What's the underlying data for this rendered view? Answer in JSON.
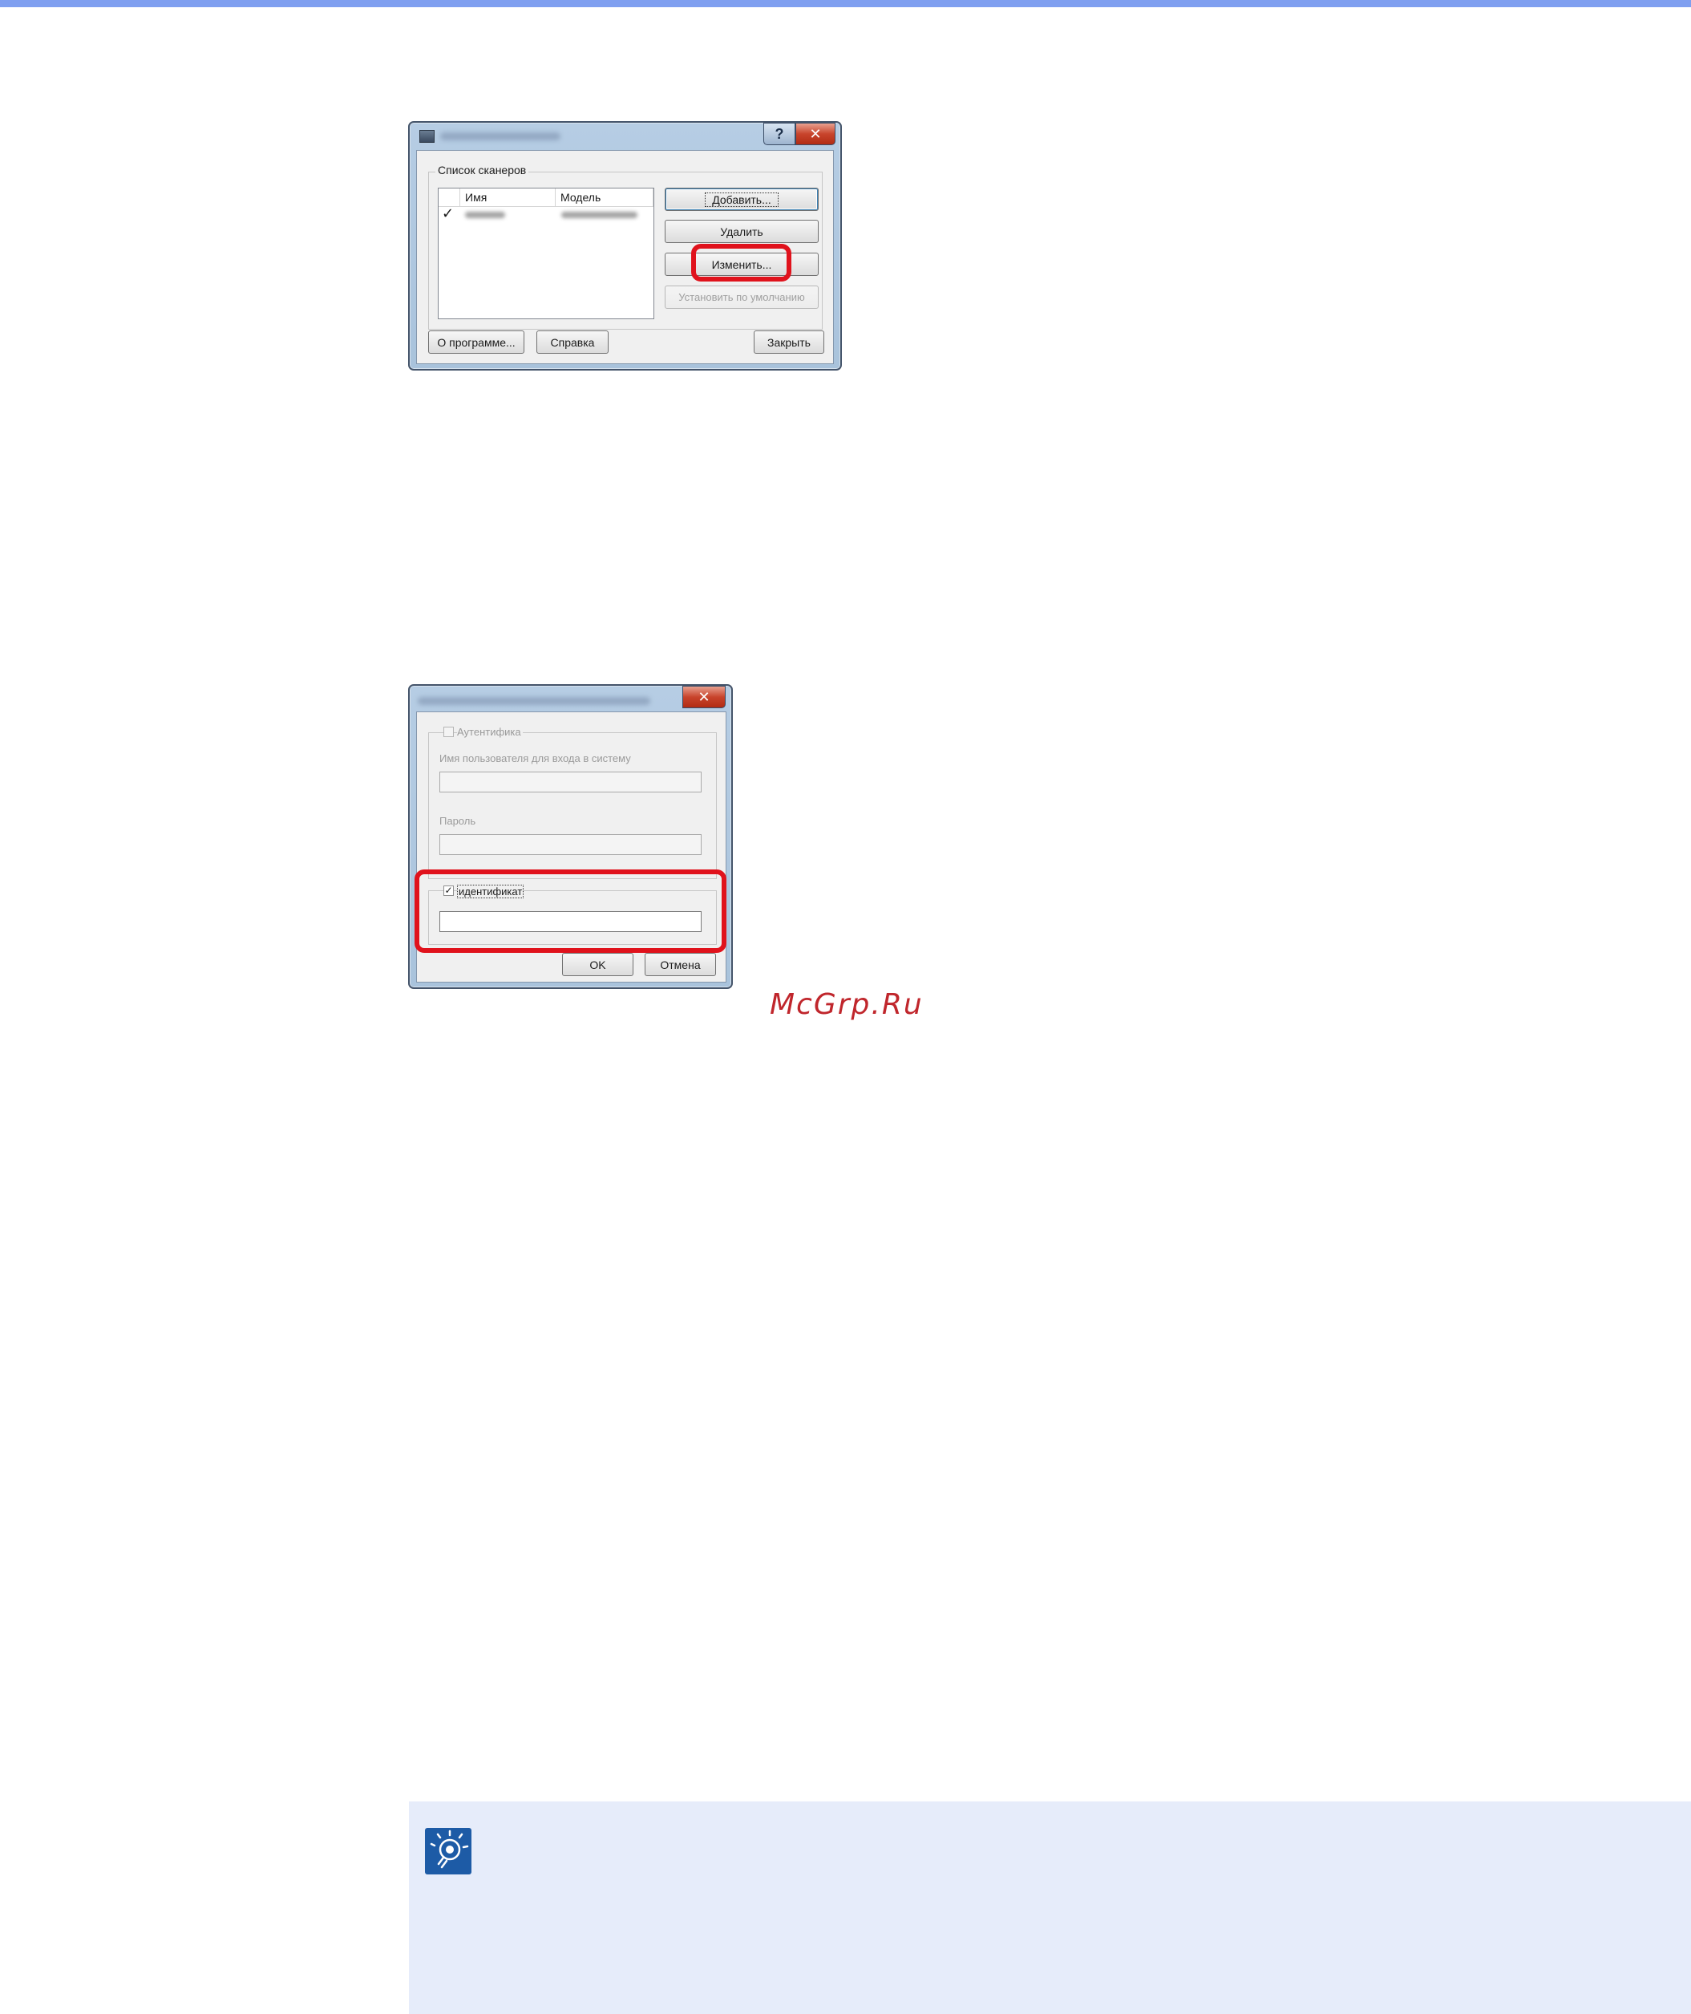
{
  "dialog1": {
    "group_label": "Список сканеров",
    "columns": [
      "Имя",
      "Модель"
    ],
    "row_check": "✓",
    "buttons": {
      "add": "Добавить...",
      "delete": "Удалить",
      "edit": "Изменить...",
      "set_default": "Установить по умолчанию",
      "about": "О программе...",
      "help": "Справка",
      "close": "Закрыть"
    },
    "help_glyph": "?",
    "close_glyph": "✕"
  },
  "dialog2": {
    "auth_label": "Аутентифика",
    "username_label": "Имя пользователя для входа в систему",
    "password_label": "Пароль",
    "id_label": "идентификат",
    "id_check": "✓",
    "ok": "OK",
    "cancel": "Отмена",
    "close_glyph": "✕"
  },
  "watermark": "McGrp.Ru",
  "colors": {
    "highlight": "#e0121c",
    "note_bg": "#e6ecfa",
    "top_bar": "#7f9ff0"
  }
}
